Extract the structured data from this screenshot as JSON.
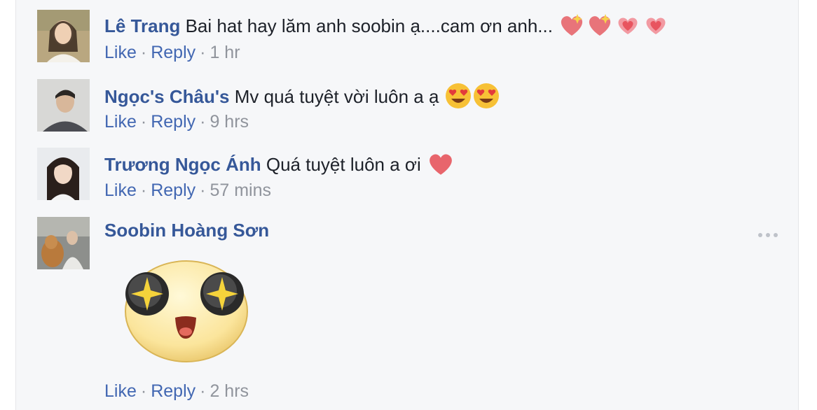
{
  "comments": [
    {
      "author": "Lê Trang",
      "text": "Bai hat hay lăm anh soobin ạ....cam ơn anh...",
      "emojis": [
        "sparkling-heart-icon",
        "sparkling-heart-icon",
        "heart-icon",
        "heart-icon"
      ],
      "like_label": "Like",
      "reply_label": "Reply",
      "time": "1 hr"
    },
    {
      "author": "Ngọc's Châu's",
      "text": "Mv quá tuyệt vời luôn a ạ",
      "emojis": [
        "heart-eyes-icon",
        "heart-eyes-icon"
      ],
      "like_label": "Like",
      "reply_label": "Reply",
      "time": "9 hrs"
    },
    {
      "author": "Trương Ngọc Ánh",
      "text": "Quá tuyệt luôn a ơi",
      "emojis": [
        "heart-icon"
      ],
      "like_label": "Like",
      "reply_label": "Reply",
      "time": "57 mins"
    },
    {
      "author": "Soobin Hoàng Sơn",
      "text": "",
      "sticker": "sparkle-eyes-sticker",
      "like_label": "Like",
      "reply_label": "Reply",
      "time": "2 hrs"
    }
  ],
  "more_icon": "ellipsis-icon",
  "colors": {
    "author": "#365899",
    "link": "#4267b2",
    "meta": "#90949c",
    "background": "#f6f7f9"
  }
}
